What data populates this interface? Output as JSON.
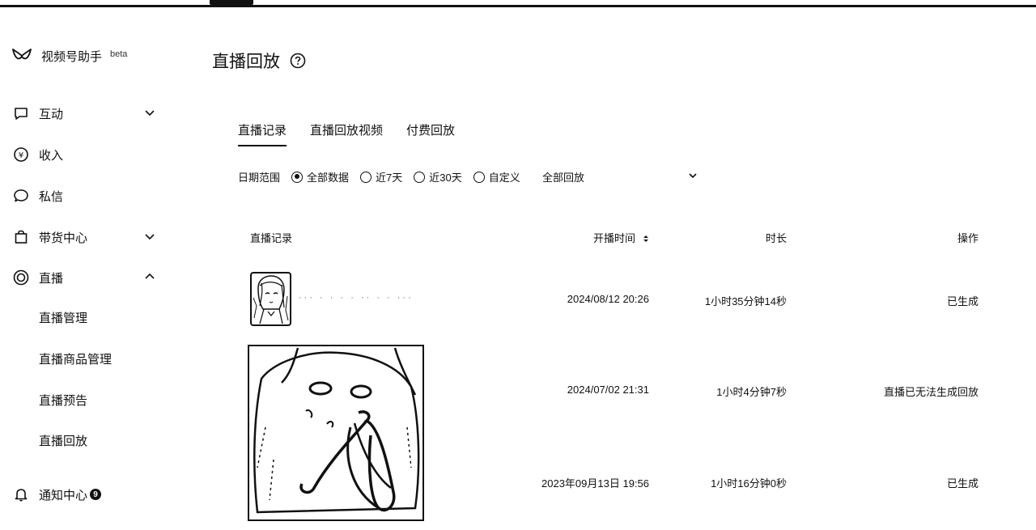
{
  "app": {
    "name": "视频号助手",
    "beta": "beta"
  },
  "sidebar": {
    "items": [
      {
        "label": "互动",
        "icon": "chat-square-icon"
      },
      {
        "label": "收入",
        "icon": "yen-circle-icon"
      },
      {
        "label": "私信",
        "icon": "message-bubble-icon"
      },
      {
        "label": "带货中心",
        "icon": "shopping-bag-icon"
      },
      {
        "label": "直播",
        "icon": "live-target-icon"
      }
    ],
    "live_subitems": [
      "直播管理",
      "直播商品管理",
      "直播预告",
      "直播回放"
    ],
    "notifications": {
      "label": "通知中心",
      "count": "9"
    }
  },
  "main": {
    "title": "直播回放",
    "tabs": [
      "直播记录",
      "直播回放视频",
      "付费回放"
    ],
    "filter": {
      "label": "日期范围",
      "options": [
        "全部数据",
        "近7天",
        "近30天",
        "自定义"
      ],
      "selected_index": 0,
      "select_value": "全部回放"
    },
    "table": {
      "headers": [
        "直播记录",
        "开播时间",
        "时长",
        "操作"
      ],
      "rows": [
        {
          "title": "··· · · · · ·· · ·  ···",
          "start": "2024/08/12 20:26",
          "duration": "1小时35分钟14秒",
          "action": "已生成"
        },
        {
          "title": "",
          "start": "2024/07/02 21:31",
          "duration": "1小时4分钟7秒",
          "action": "直播已无法生成回放"
        },
        {
          "title": "",
          "start": "2023年09月13日 19:56",
          "duration": "1小时16分钟0秒",
          "action": "已生成"
        }
      ]
    }
  }
}
